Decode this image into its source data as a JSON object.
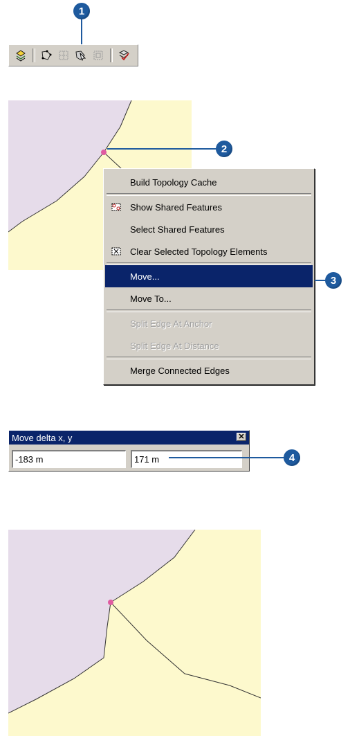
{
  "steps": [
    "1",
    "2",
    "3",
    "4"
  ],
  "toolbar": {
    "buttons": [
      {
        "icon": "topology-layer-icon"
      },
      {
        "icon": "map-topology-icon"
      },
      {
        "icon": "topology-edit-tool-icon"
      },
      {
        "icon": "show-shared-features-icon"
      },
      {
        "icon": "select-topology-icon"
      },
      {
        "icon": "validate-topology-icon"
      }
    ]
  },
  "context_menu": {
    "items": [
      {
        "label": "Build Topology Cache",
        "enabled": true
      },
      {
        "label": "Show Shared Features",
        "enabled": true,
        "icon": "shared-features-icon"
      },
      {
        "label": "Select Shared Features",
        "enabled": true
      },
      {
        "label": "Clear Selected Topology Elements",
        "enabled": true,
        "icon": "clear-topology-icon"
      },
      {
        "label": "Move...",
        "enabled": true,
        "highlighted": true
      },
      {
        "label": "Move To...",
        "enabled": true
      },
      {
        "label": "Split Edge At Anchor",
        "enabled": false
      },
      {
        "label": "Split Edge At Distance",
        "enabled": false
      },
      {
        "label": "Merge Connected Edges",
        "enabled": true
      }
    ]
  },
  "move_dialog": {
    "title": "Move delta x, y",
    "close_glyph": "✕",
    "delta_x": "-183 m",
    "delta_y": "171 m"
  },
  "colors": {
    "callout": "#1e5a9e",
    "polygon_purple": "#e6dcea",
    "polygon_yellow": "#fdf9cd",
    "vertex": "#e05aa0",
    "menu_bg": "#d4d0c8",
    "highlight": "#0a246a"
  }
}
